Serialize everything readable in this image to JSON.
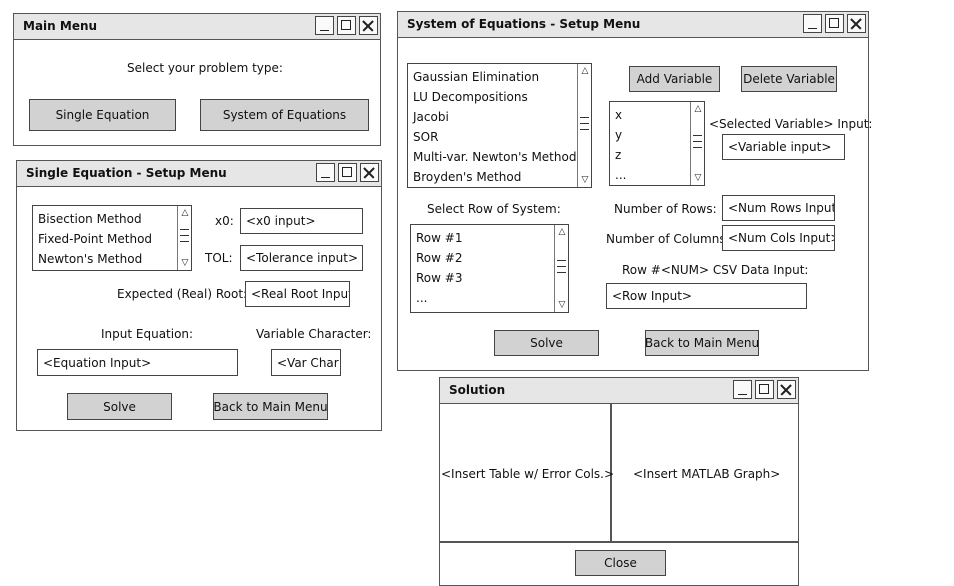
{
  "main_menu": {
    "title": "Main Menu",
    "prompt": "Select your problem type:",
    "single_equation_label": "Single Equation",
    "system_equations_label": "System of Equations"
  },
  "single_setup": {
    "title": "Single Equation - Setup Menu",
    "methods": [
      "Bisection Method",
      "Fixed-Point Method",
      "Newton's Method"
    ],
    "x0_label": "x0:",
    "x0_value": "<x0 input>",
    "tol_label": "TOL:",
    "tol_value": "<Tolerance input>",
    "root_label": "Expected (Real) Root:",
    "root_value": "<Real Root Input>",
    "equation_label": "Input Equation:",
    "equation_value": "<Equation Input>",
    "var_char_label": "Variable Character:",
    "var_char_value": "<Var Char>",
    "solve_label": "Solve",
    "back_label": "Back to Main Menu"
  },
  "system_setup": {
    "title": "System of Equations - Setup Menu",
    "methods": [
      "Gaussian Elimination",
      "LU Decompositions",
      "Jacobi",
      "SOR",
      "Multi-var. Newton's Method",
      "Broyden's Method"
    ],
    "add_variable_label": "Add Variable",
    "delete_variable_label": "Delete Variable",
    "variables": [
      "x",
      "y",
      "z",
      "..."
    ],
    "selected_var_label": "<Selected Variable> Input:",
    "variable_input_value": "<Variable input>",
    "select_row_label": "Select Row of System:",
    "rows": [
      "Row #1",
      "Row #2",
      "Row #3",
      "..."
    ],
    "num_rows_label": "Number of Rows:",
    "num_rows_value": "<Num Rows Input>",
    "num_cols_label": "Number of Columns:",
    "num_cols_value": "<Num Cols Input>",
    "csv_label": "Row #<NUM> CSV Data Input:",
    "row_input_value": "<Row Input>",
    "solve_label": "Solve",
    "back_label": "Back to Main Menu"
  },
  "solution": {
    "title": "Solution",
    "table_placeholder": "<Insert Table w/ Error Cols.>",
    "graph_placeholder": "<Insert MATLAB Graph>",
    "close_label": "Close"
  }
}
